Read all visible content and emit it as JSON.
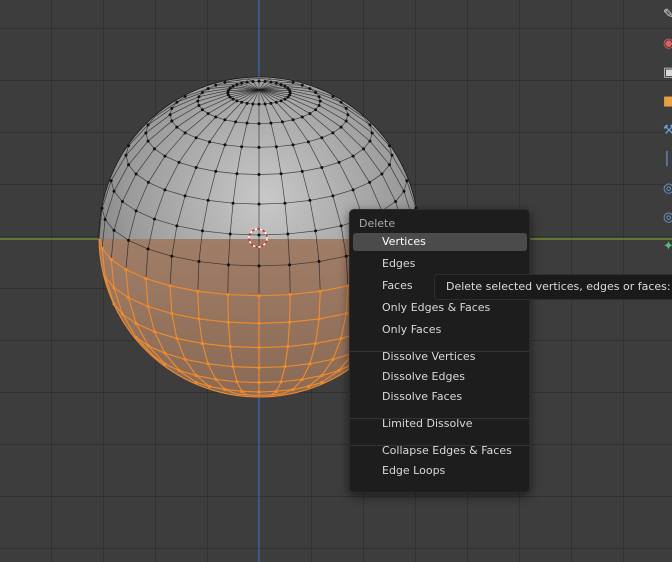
{
  "menu": {
    "title": "Delete",
    "groups": [
      [
        {
          "label": "Vertices",
          "active": true
        },
        {
          "label": "Edges"
        },
        {
          "label": "Faces"
        },
        {
          "label": "Only Edges & Faces"
        },
        {
          "label": "Only Faces"
        }
      ],
      [
        {
          "label": "Dissolve Vertices"
        },
        {
          "label": "Dissolve Edges"
        },
        {
          "label": "Dissolve Faces"
        }
      ],
      [
        {
          "label": "Limited Dissolve"
        }
      ],
      [
        {
          "label": "Collapse Edges & Faces"
        },
        {
          "label": "Edge Loops"
        }
      ]
    ]
  },
  "tooltip": {
    "text": "Delete selected vertices, edges or faces:  Ve"
  },
  "toolbar": {
    "icons": [
      "annotate-icon",
      "measure-icon",
      "add-cube-icon",
      "extrude-icon",
      "inset-icon",
      "bevel-icon",
      "loop-cut-icon",
      "knife-icon",
      "poly-build-icon"
    ]
  },
  "colors": {
    "viewport_bg": "#3d3d3d",
    "grid_line": "#333333",
    "x_axis": "#7a9a2c",
    "y_axis": "#3b6fb6",
    "mesh_unselected": "#b4b4b4",
    "mesh_selected": "#f08b2c",
    "menu_bg": "#1d1d1d",
    "menu_highlight": "#4b4b4b"
  }
}
